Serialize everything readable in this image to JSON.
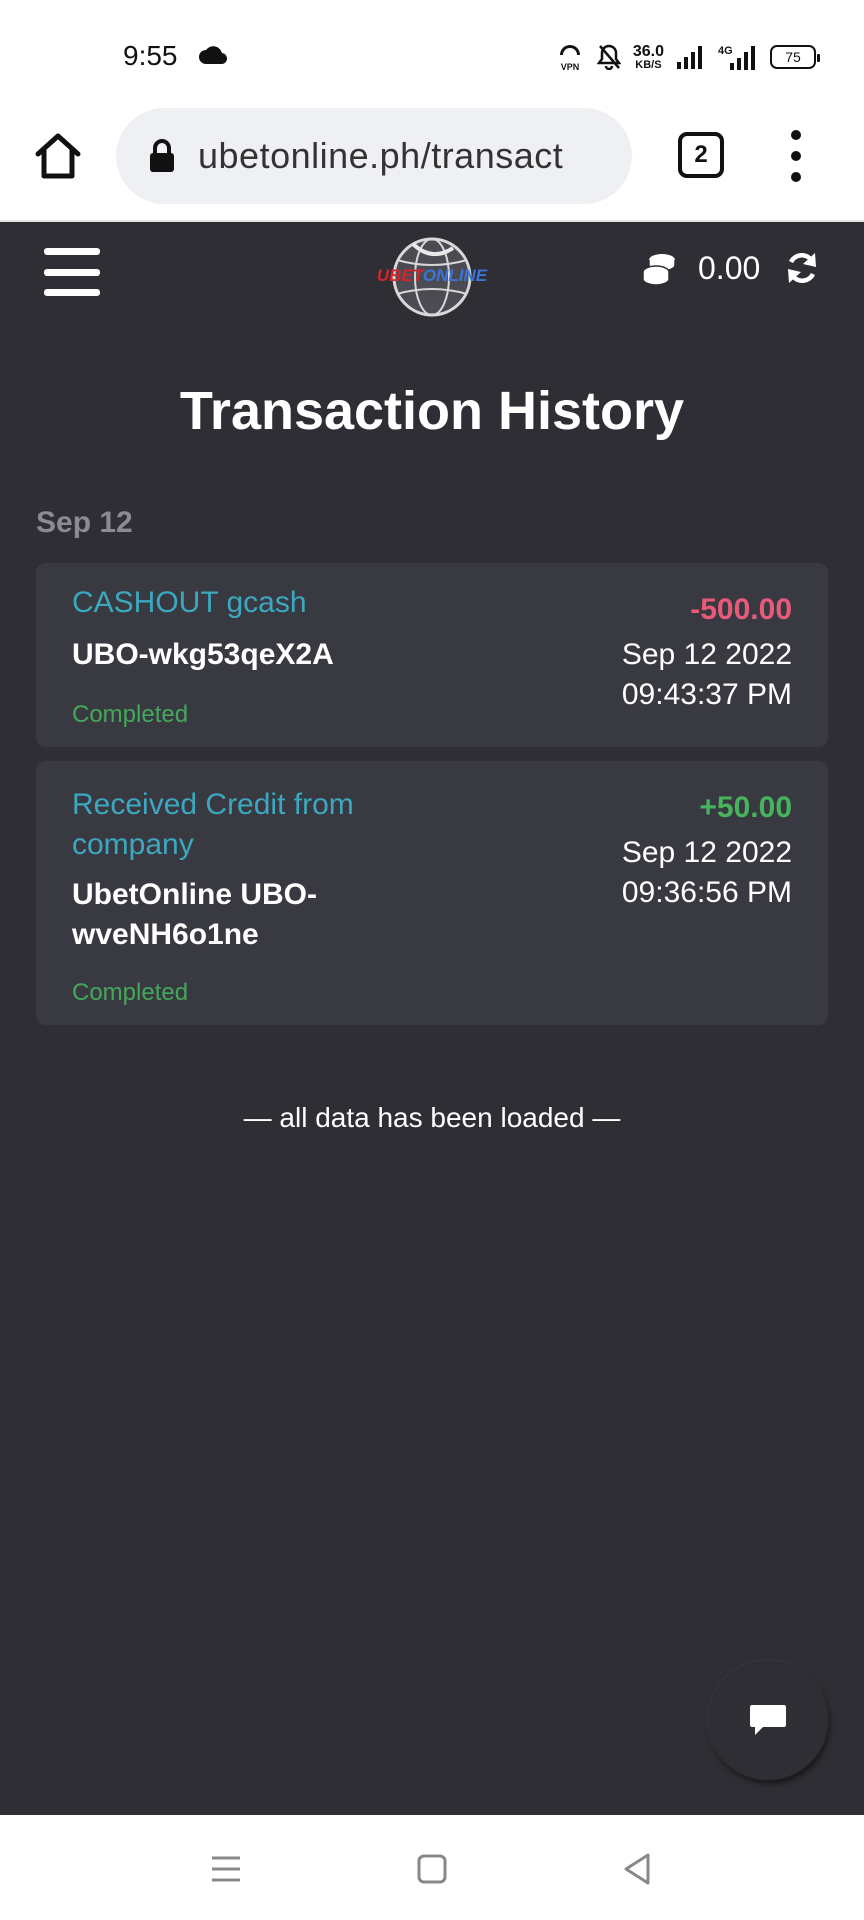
{
  "status_bar": {
    "time": "9:55",
    "vpn_label": "VPN",
    "net_speed": "36.0",
    "net_speed_unit": "KB/S",
    "network_type": "4G",
    "battery": "75"
  },
  "browser": {
    "url": "ubetonline.ph/transact",
    "tab_count": "2"
  },
  "header": {
    "logo_text": "UBETONLINE",
    "balance": "0.00"
  },
  "page": {
    "title": "Transaction History",
    "date_group": "Sep 12",
    "end_message": "— all data has been loaded —"
  },
  "transactions": [
    {
      "title": "CASHOUT gcash",
      "reference": "UBO-wkg53qeX2A",
      "status": "Completed",
      "amount": "-500.00",
      "date": "Sep 12 2022",
      "time": "09:43:37 PM"
    },
    {
      "title": "Received Credit from company",
      "reference": "UbetOnline UBO-wveNH6o1ne",
      "status": "Completed",
      "amount": "+50.00",
      "date": "Sep 12 2022",
      "time": "09:36:56 PM"
    }
  ],
  "colors": {
    "page_bg": "#2f2e35",
    "card_bg": "#393a41",
    "accent_teal": "#3ba8bf",
    "negative": "#e85a7a",
    "positive": "#45b45d"
  }
}
